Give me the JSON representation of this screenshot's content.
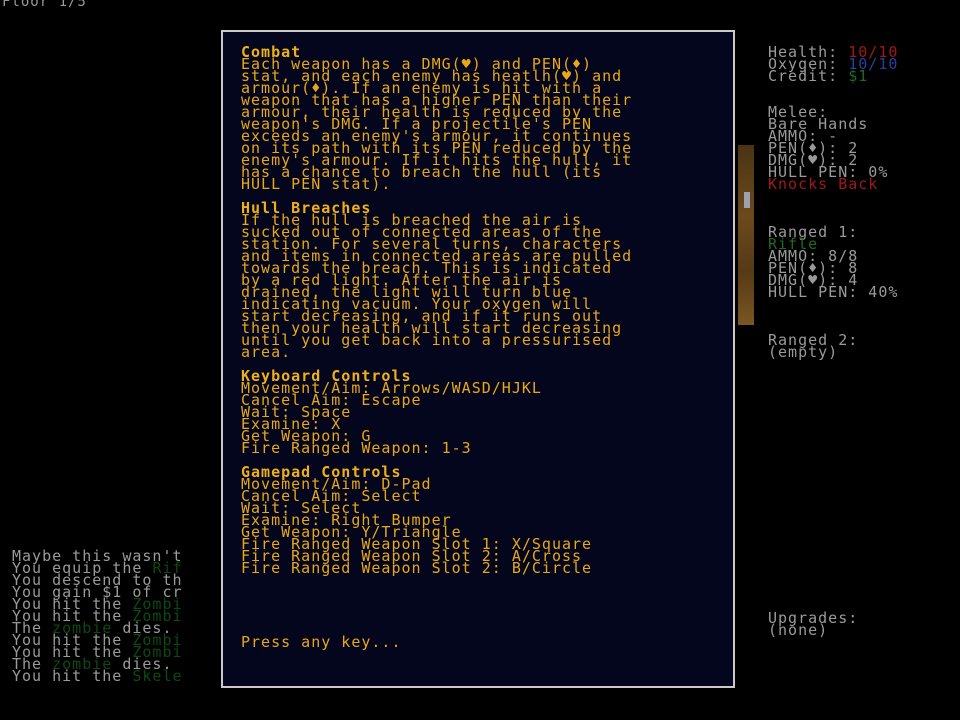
{
  "floor_label": "Floor 1/5",
  "stats": {
    "health_label": "Health:",
    "health_value": "10/10",
    "oxygen_label": "Oxygen:",
    "oxygen_value": "10/10",
    "credit_label": "Credit:",
    "credit_value": "$1",
    "melee_label": "Melee:",
    "melee_name": "Bare Hands",
    "melee_ammo": "AMMO: -",
    "melee_pen": "PEN(♦): 2",
    "melee_dmg": "DMG(♥): 2",
    "melee_hull_pen": "HULL PEN: 0%",
    "melee_special": "Knocks Back",
    "ranged1_label": "Ranged 1:",
    "ranged1_name": "Rifle",
    "ranged1_ammo": "AMMO: 8/8",
    "ranged1_pen": "PEN(♦): 8",
    "ranged1_dmg": "DMG(♥): 4",
    "ranged1_hull_pen": "HULL PEN: 40%",
    "ranged2_label": "Ranged 2:",
    "ranged2_value": "(empty)",
    "upgrades_label": "Upgrades:",
    "upgrades_value": "(none)"
  },
  "log": [
    {
      "a": "Maybe this wasn't",
      "b": ""
    },
    {
      "a": "You equip the ",
      "b": "Rif"
    },
    {
      "a": "You descend to th",
      "b": ""
    },
    {
      "a": "You gain $1 of cr",
      "b": ""
    },
    {
      "a": "You hit the ",
      "b": "Zombi"
    },
    {
      "a": "You hit the ",
      "b": "Zombi"
    },
    {
      "a": "The ",
      "b": "zombie",
      "c": " dies."
    },
    {
      "a": "You hit the ",
      "b": "Zombi"
    },
    {
      "a": "You hit the ",
      "b": "Zombi"
    },
    {
      "a": "The ",
      "b": "zombie",
      "c": " dies."
    },
    {
      "a": "You hit the ",
      "b": "Skele"
    }
  ],
  "help": {
    "combat_title": "Combat",
    "combat_lines": [
      "Each weapon has a DMG(♥) and PEN(♦)",
      "stat, and each enemy has heatlh(♥) and",
      "armour(♦). If an enemy is hit with a",
      "weapon that has a higher PEN than their",
      "armour, their health is reduced by the",
      "weapon's DMG. If a projectile's PEN",
      "exceeds an enemy's armour, it continues",
      "on its path with its PEN reduced by the",
      "enemy's armour. If it hits the hull, it",
      "has a chance to breach the hull (its",
      "HULL PEN stat)."
    ],
    "hull_title": "Hull Breaches",
    "hull_lines": [
      "If the hull is breached the air is",
      "sucked out of connected areas of the",
      "station. For several turns, characters",
      "and items in connected areas are pulled",
      "towards the breach. This is indicated",
      "by a red light. After the air is",
      "drained, the light will turn blue",
      "indicating vacuum. Your oxygen will",
      "start decreasing, and if it runs out",
      "then your health will start decreasing",
      "until you get back into a pressurised",
      "area."
    ],
    "keyboard_title": "Keyboard Controls",
    "keyboard_lines": [
      "Movement/Aim: Arrows/WASD/HJKL",
      "Cancel Aim: Escape",
      "Wait: Space",
      "Examine: X",
      "Get Weapon: G",
      "Fire Ranged Weapon: 1-3"
    ],
    "gamepad_title": "Gamepad Controls",
    "gamepad_lines": [
      "Movement/Aim: D-Pad",
      "Cancel Aim: Select",
      "Wait: Select",
      "Examine: Right Bumper",
      "Get Weapon: Y/Triangle",
      "Fire Ranged Weapon Slot 1: X/Square",
      "Fire Ranged Weapon Slot 2: A/Cross",
      "Fire Ranged Weapon Slot 2: B/Circle"
    ],
    "prompt": "Press any key..."
  },
  "colors": {
    "panel_bg": "#04061e",
    "text_gold": "#e8a818",
    "health_red": "#a01818",
    "oxygen_blue": "#2b3fa0",
    "credit_green": "#1e6a22"
  }
}
